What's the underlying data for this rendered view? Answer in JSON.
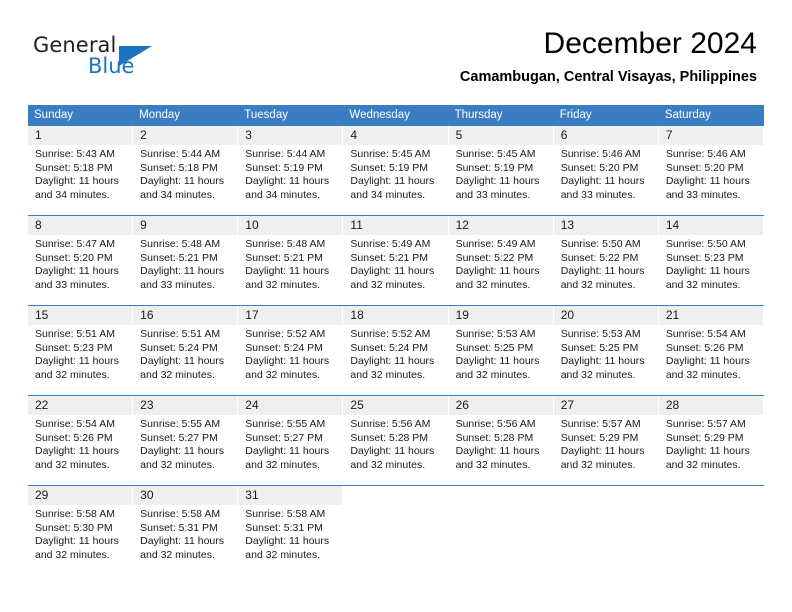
{
  "logo": {
    "word_top": "General",
    "word_bottom": "Blue",
    "triangle_color": "#1b75bc"
  },
  "header": {
    "month_title": "December 2024",
    "location": "Camambugan, Central Visayas, Philippines"
  },
  "theme": {
    "header_blue": "#3b7dc2",
    "daynum_gray": "#efefef",
    "text_black": "#1a1a1a"
  },
  "calendar": {
    "weekday_headers": [
      "Sunday",
      "Monday",
      "Tuesday",
      "Wednesday",
      "Thursday",
      "Friday",
      "Saturday"
    ],
    "weeks": [
      [
        {
          "day": "1",
          "sunrise": "Sunrise: 5:43 AM",
          "sunset": "Sunset: 5:18 PM",
          "daylight": "Daylight: 11 hours and 34 minutes."
        },
        {
          "day": "2",
          "sunrise": "Sunrise: 5:44 AM",
          "sunset": "Sunset: 5:18 PM",
          "daylight": "Daylight: 11 hours and 34 minutes."
        },
        {
          "day": "3",
          "sunrise": "Sunrise: 5:44 AM",
          "sunset": "Sunset: 5:19 PM",
          "daylight": "Daylight: 11 hours and 34 minutes."
        },
        {
          "day": "4",
          "sunrise": "Sunrise: 5:45 AM",
          "sunset": "Sunset: 5:19 PM",
          "daylight": "Daylight: 11 hours and 34 minutes."
        },
        {
          "day": "5",
          "sunrise": "Sunrise: 5:45 AM",
          "sunset": "Sunset: 5:19 PM",
          "daylight": "Daylight: 11 hours and 33 minutes."
        },
        {
          "day": "6",
          "sunrise": "Sunrise: 5:46 AM",
          "sunset": "Sunset: 5:20 PM",
          "daylight": "Daylight: 11 hours and 33 minutes."
        },
        {
          "day": "7",
          "sunrise": "Sunrise: 5:46 AM",
          "sunset": "Sunset: 5:20 PM",
          "daylight": "Daylight: 11 hours and 33 minutes."
        }
      ],
      [
        {
          "day": "8",
          "sunrise": "Sunrise: 5:47 AM",
          "sunset": "Sunset: 5:20 PM",
          "daylight": "Daylight: 11 hours and 33 minutes."
        },
        {
          "day": "9",
          "sunrise": "Sunrise: 5:48 AM",
          "sunset": "Sunset: 5:21 PM",
          "daylight": "Daylight: 11 hours and 33 minutes."
        },
        {
          "day": "10",
          "sunrise": "Sunrise: 5:48 AM",
          "sunset": "Sunset: 5:21 PM",
          "daylight": "Daylight: 11 hours and 32 minutes."
        },
        {
          "day": "11",
          "sunrise": "Sunrise: 5:49 AM",
          "sunset": "Sunset: 5:21 PM",
          "daylight": "Daylight: 11 hours and 32 minutes."
        },
        {
          "day": "12",
          "sunrise": "Sunrise: 5:49 AM",
          "sunset": "Sunset: 5:22 PM",
          "daylight": "Daylight: 11 hours and 32 minutes."
        },
        {
          "day": "13",
          "sunrise": "Sunrise: 5:50 AM",
          "sunset": "Sunset: 5:22 PM",
          "daylight": "Daylight: 11 hours and 32 minutes."
        },
        {
          "day": "14",
          "sunrise": "Sunrise: 5:50 AM",
          "sunset": "Sunset: 5:23 PM",
          "daylight": "Daylight: 11 hours and 32 minutes."
        }
      ],
      [
        {
          "day": "15",
          "sunrise": "Sunrise: 5:51 AM",
          "sunset": "Sunset: 5:23 PM",
          "daylight": "Daylight: 11 hours and 32 minutes."
        },
        {
          "day": "16",
          "sunrise": "Sunrise: 5:51 AM",
          "sunset": "Sunset: 5:24 PM",
          "daylight": "Daylight: 11 hours and 32 minutes."
        },
        {
          "day": "17",
          "sunrise": "Sunrise: 5:52 AM",
          "sunset": "Sunset: 5:24 PM",
          "daylight": "Daylight: 11 hours and 32 minutes."
        },
        {
          "day": "18",
          "sunrise": "Sunrise: 5:52 AM",
          "sunset": "Sunset: 5:24 PM",
          "daylight": "Daylight: 11 hours and 32 minutes."
        },
        {
          "day": "19",
          "sunrise": "Sunrise: 5:53 AM",
          "sunset": "Sunset: 5:25 PM",
          "daylight": "Daylight: 11 hours and 32 minutes."
        },
        {
          "day": "20",
          "sunrise": "Sunrise: 5:53 AM",
          "sunset": "Sunset: 5:25 PM",
          "daylight": "Daylight: 11 hours and 32 minutes."
        },
        {
          "day": "21",
          "sunrise": "Sunrise: 5:54 AM",
          "sunset": "Sunset: 5:26 PM",
          "daylight": "Daylight: 11 hours and 32 minutes."
        }
      ],
      [
        {
          "day": "22",
          "sunrise": "Sunrise: 5:54 AM",
          "sunset": "Sunset: 5:26 PM",
          "daylight": "Daylight: 11 hours and 32 minutes."
        },
        {
          "day": "23",
          "sunrise": "Sunrise: 5:55 AM",
          "sunset": "Sunset: 5:27 PM",
          "daylight": "Daylight: 11 hours and 32 minutes."
        },
        {
          "day": "24",
          "sunrise": "Sunrise: 5:55 AM",
          "sunset": "Sunset: 5:27 PM",
          "daylight": "Daylight: 11 hours and 32 minutes."
        },
        {
          "day": "25",
          "sunrise": "Sunrise: 5:56 AM",
          "sunset": "Sunset: 5:28 PM",
          "daylight": "Daylight: 11 hours and 32 minutes."
        },
        {
          "day": "26",
          "sunrise": "Sunrise: 5:56 AM",
          "sunset": "Sunset: 5:28 PM",
          "daylight": "Daylight: 11 hours and 32 minutes."
        },
        {
          "day": "27",
          "sunrise": "Sunrise: 5:57 AM",
          "sunset": "Sunset: 5:29 PM",
          "daylight": "Daylight: 11 hours and 32 minutes."
        },
        {
          "day": "28",
          "sunrise": "Sunrise: 5:57 AM",
          "sunset": "Sunset: 5:29 PM",
          "daylight": "Daylight: 11 hours and 32 minutes."
        }
      ],
      [
        {
          "day": "29",
          "sunrise": "Sunrise: 5:58 AM",
          "sunset": "Sunset: 5:30 PM",
          "daylight": "Daylight: 11 hours and 32 minutes."
        },
        {
          "day": "30",
          "sunrise": "Sunrise: 5:58 AM",
          "sunset": "Sunset: 5:31 PM",
          "daylight": "Daylight: 11 hours and 32 minutes."
        },
        {
          "day": "31",
          "sunrise": "Sunrise: 5:58 AM",
          "sunset": "Sunset: 5:31 PM",
          "daylight": "Daylight: 11 hours and 32 minutes."
        },
        {
          "day": "",
          "sunrise": "",
          "sunset": "",
          "daylight": ""
        },
        {
          "day": "",
          "sunrise": "",
          "sunset": "",
          "daylight": ""
        },
        {
          "day": "",
          "sunrise": "",
          "sunset": "",
          "daylight": ""
        },
        {
          "day": "",
          "sunrise": "",
          "sunset": "",
          "daylight": ""
        }
      ]
    ]
  }
}
